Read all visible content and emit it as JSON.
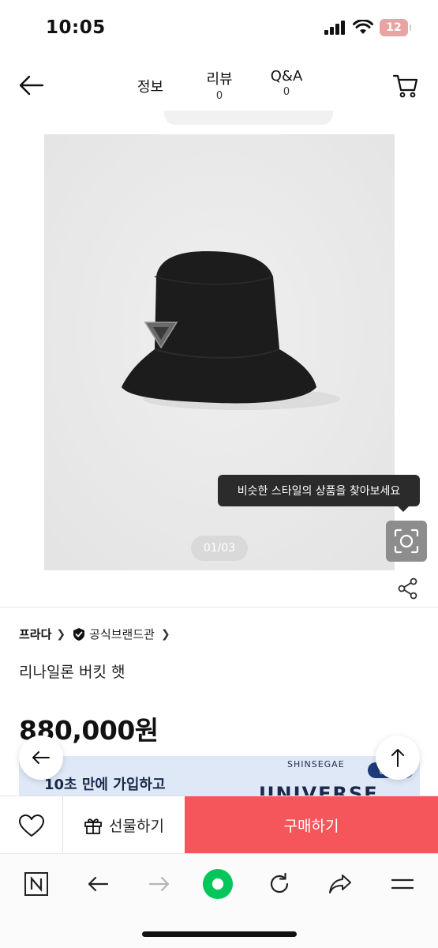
{
  "status_bar": {
    "time": "10:05",
    "battery": "12",
    "icons": [
      "signal-icon",
      "wifi-icon",
      "battery-icon"
    ]
  },
  "nav": {
    "tabs": [
      {
        "label": "정보",
        "count": ""
      },
      {
        "label": "리뷰",
        "count": "0"
      },
      {
        "label": "Q&A",
        "count": "0"
      }
    ]
  },
  "gallery": {
    "page_indicator": "01/03",
    "tooltip": "비슷한 스타일의 상품을 찾아보세요"
  },
  "product": {
    "brand": "프라다",
    "official_store": "공식브랜드관",
    "title": "리나일론 버킷 햇",
    "price": "880,000원"
  },
  "banner": {
    "text": "10초 만에 가입하고",
    "brand_small": "SHINSEGAE",
    "brand_large": "UNIVERSE",
    "badge": "U 혜택"
  },
  "actions": {
    "gift": "선물하기",
    "buy": "구매하기"
  },
  "colors": {
    "buy_button": "#f4565c",
    "naver_green": "#03c75a",
    "banner_bg": "#dfe8f7"
  }
}
